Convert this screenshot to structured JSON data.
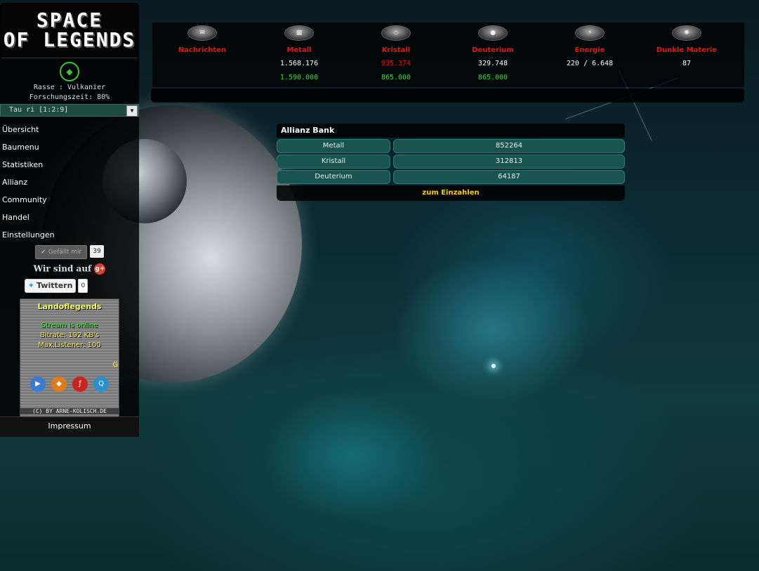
{
  "logo": {
    "line1": "SPACE",
    "line2": "OF LEGENDS"
  },
  "player": {
    "race": "Rasse : Vulkanier",
    "research_time": "Forschungszeit: 80%",
    "planet_select": "Tau ri [1:2:9]"
  },
  "nav": {
    "items": [
      {
        "label": "Übersicht"
      },
      {
        "label": "Baumenu"
      },
      {
        "label": "Statistiken"
      },
      {
        "label": "Allianz"
      },
      {
        "label": "Community"
      },
      {
        "label": "Handel"
      },
      {
        "label": "Einstellungen"
      }
    ]
  },
  "social": {
    "like_label": "Gefällt mir",
    "like_count": "39",
    "gplus_text": "Wir sind auf",
    "gplus_icon": "g+",
    "twitter_label": "Twittern",
    "twitter_count": "0"
  },
  "radio": {
    "title": "Landoflegends",
    "status": "Stream is online",
    "bitrate": "Bitrate: 192 KB's",
    "listeners": "Max.Listener: 100",
    "side": "G",
    "copyright": "(C) BY ARNE-KOLISCH.DE"
  },
  "footer": {
    "impressum": "Impressum"
  },
  "resources": [
    {
      "name": "Nachrichten",
      "value": "",
      "capacity": "",
      "value_color": "#ffffff",
      "icon": "messages-icon"
    },
    {
      "name": "Metall",
      "value": "1.568.176",
      "capacity": "1.590.000",
      "value_color": "#ffffff",
      "icon": "metal-icon"
    },
    {
      "name": "Kristall",
      "value": "935.374",
      "capacity": "865.000",
      "value_color": "#ee1111",
      "icon": "crystal-icon"
    },
    {
      "name": "Deuterium",
      "value": "329.748",
      "capacity": "865.000",
      "value_color": "#ffffff",
      "icon": "deuterium-icon"
    },
    {
      "name": "Energie",
      "value": "220 / 6.648",
      "capacity": "",
      "value_color": "#ffffff",
      "icon": "energy-icon"
    },
    {
      "name": "Dunkle Materie",
      "value": "87",
      "capacity": "",
      "value_color": "#ffffff",
      "icon": "dark-matter-icon"
    }
  ],
  "bank": {
    "title": "Allianz Bank",
    "rows": [
      {
        "label": "Metall",
        "value": "852264"
      },
      {
        "label": "Kristall",
        "value": "312813"
      },
      {
        "label": "Deuterium",
        "value": "64187"
      }
    ],
    "deposit_label": "zum Einzahlen"
  },
  "colors": {
    "resource_name": "#ee1111",
    "capacity": "#33dd33",
    "bank_cell": "#1a5450",
    "deposit": "#ffcc00"
  }
}
